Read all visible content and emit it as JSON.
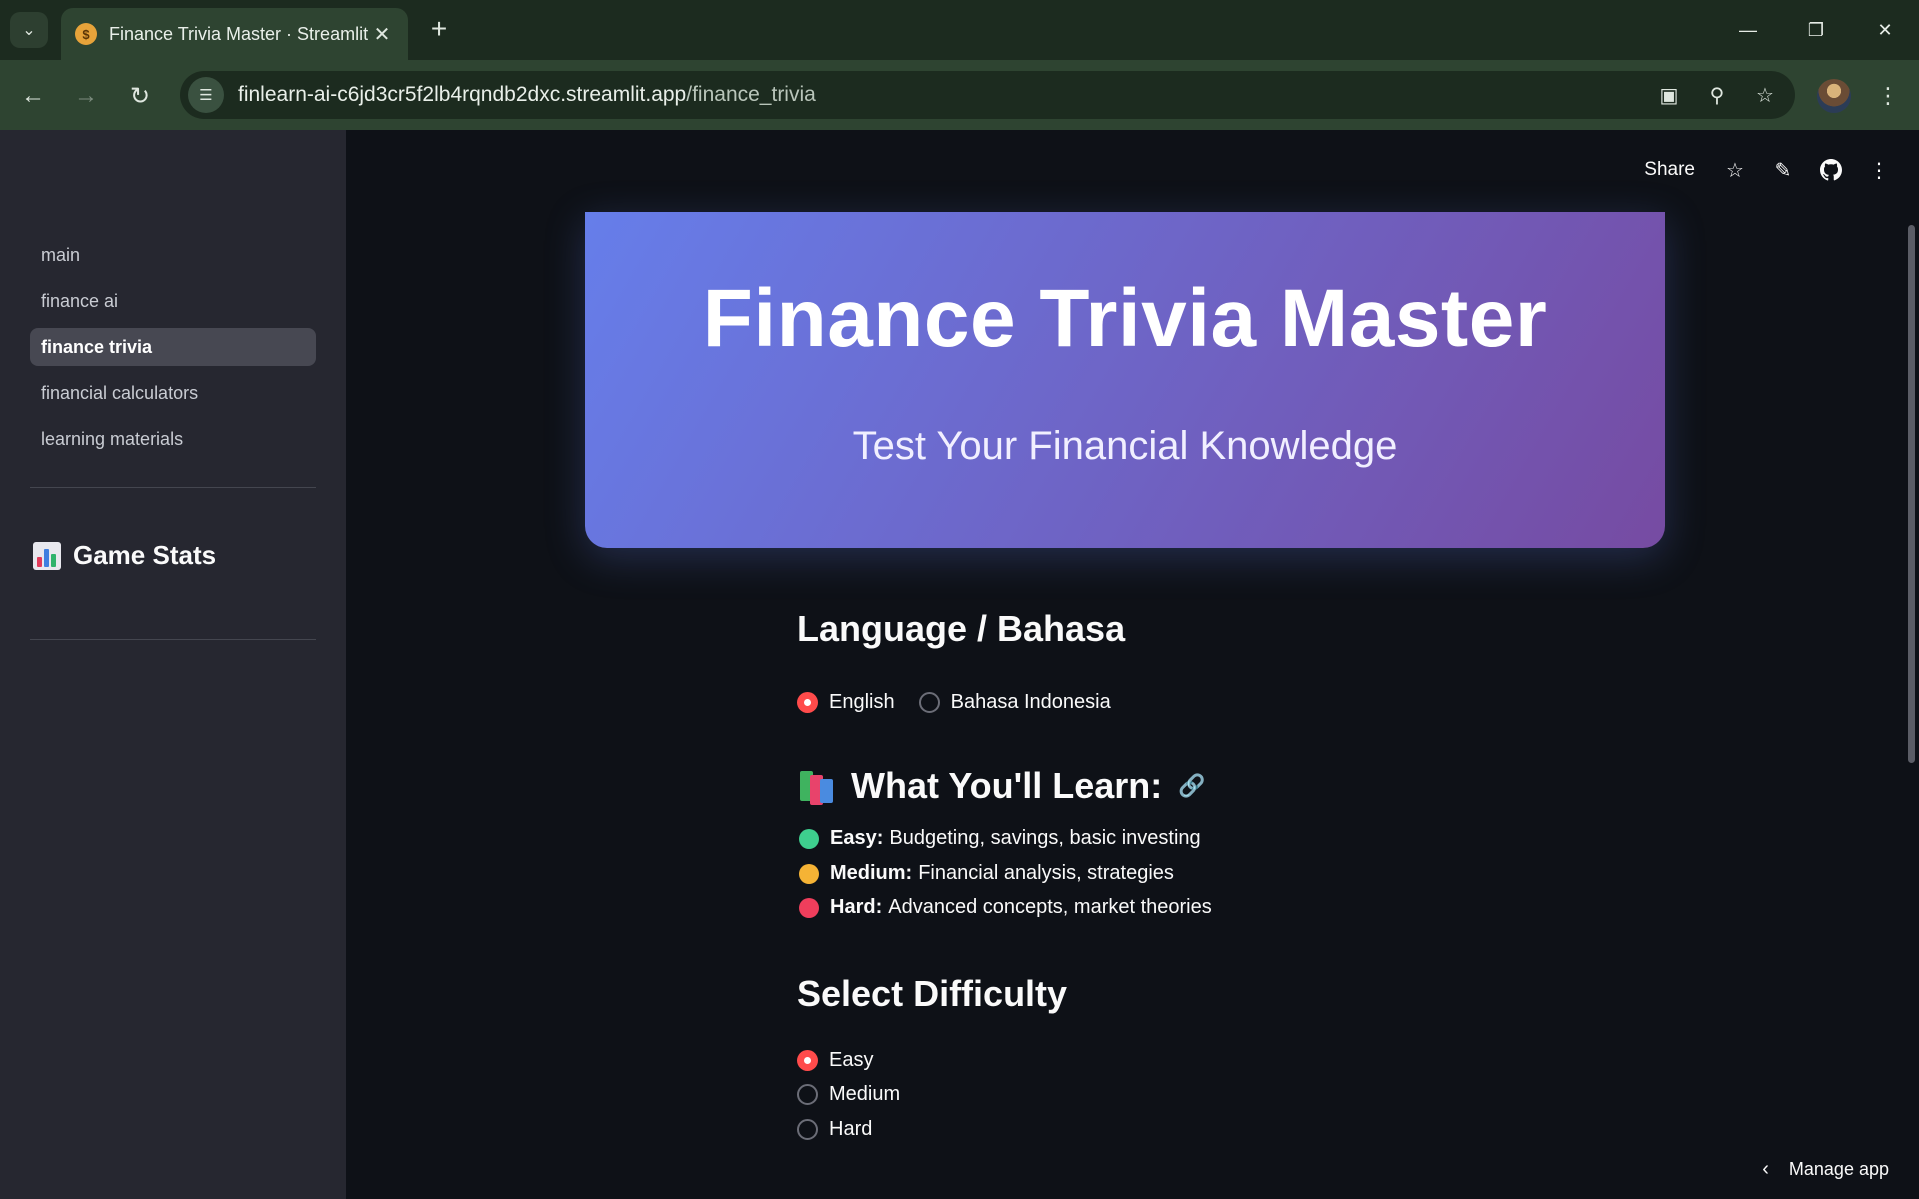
{
  "browser": {
    "tab_title": "Finance Trivia Master · Streamlit",
    "tab_favicon": "money-bag-icon",
    "new_tab_label": "+",
    "url_host": "finlearn-ai-c6jd3cr5f2lb4rqndb2dxc.streamlit.app",
    "url_path": "/finance_trivia"
  },
  "sidebar": {
    "nav_items": [
      {
        "label": "main"
      },
      {
        "label": "finance ai"
      },
      {
        "label": "finance trivia",
        "active": true
      },
      {
        "label": "financial calculators"
      },
      {
        "label": "learning materials"
      }
    ],
    "stats_heading": "Game Stats",
    "stats_icon": "bar-chart-icon"
  },
  "header": {
    "share_label": "Share"
  },
  "hero": {
    "title": "Finance Trivia Master",
    "subtitle": "Test Your Financial Knowledge",
    "gradient": [
      "#667eea",
      "#764ba2"
    ]
  },
  "language": {
    "heading": "Language / Bahasa",
    "options": [
      "English",
      "Bahasa Indonesia"
    ],
    "selected": "English"
  },
  "learn": {
    "heading": "What You'll Learn:",
    "icon": "books-icon",
    "items": [
      {
        "level": "Easy:",
        "text": "Budgeting, savings, basic investing",
        "color": "#3ecf8e"
      },
      {
        "level": "Medium:",
        "text": "Financial analysis, strategies",
        "color": "#f5b335"
      },
      {
        "level": "Hard:",
        "text": "Advanced concepts, market theories",
        "color": "#ef3e5c"
      }
    ]
  },
  "difficulty": {
    "heading": "Select Difficulty",
    "options": [
      "Easy",
      "Medium",
      "Hard"
    ],
    "selected": "Easy"
  },
  "footer": {
    "manage_app_label": "Manage app"
  },
  "colors": {
    "accent": "#ff4b4b",
    "sidebar_bg": "#262730",
    "main_bg": "#0e1117"
  }
}
